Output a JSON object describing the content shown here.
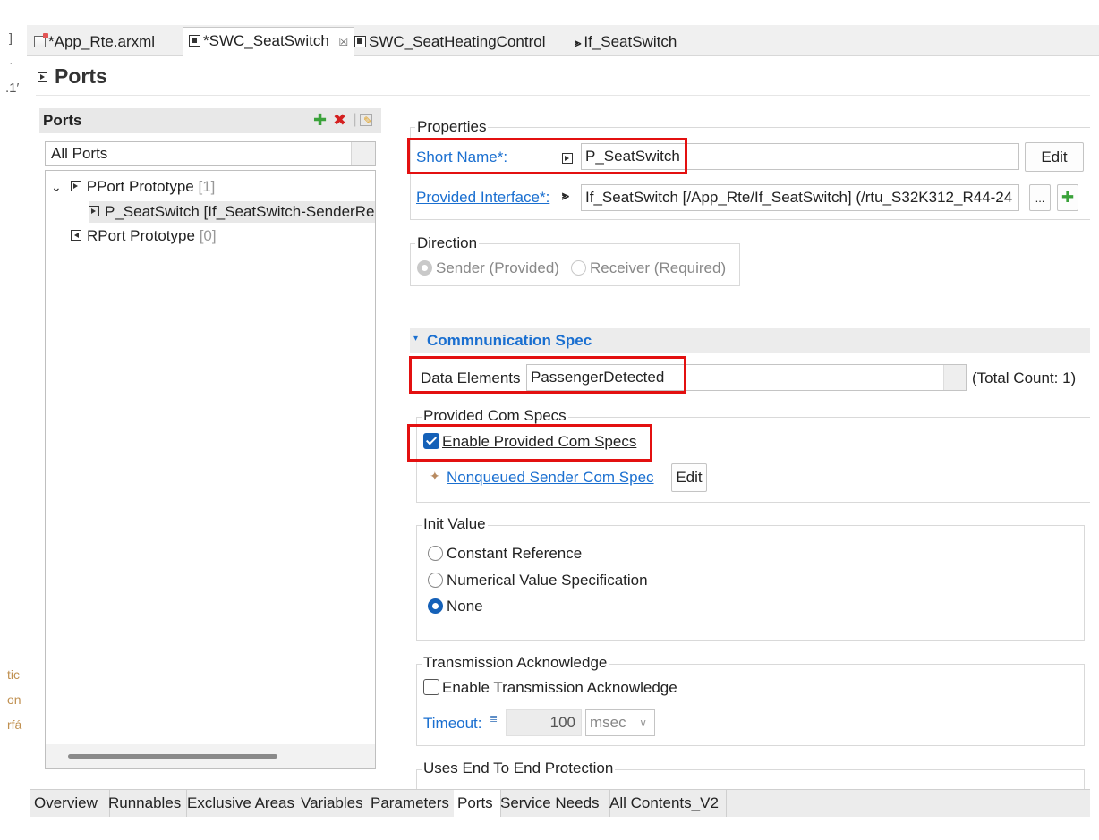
{
  "tabs": [
    {
      "label": "*App_Rte.arxml",
      "icon": "arxml-file-icon"
    },
    {
      "label": "*SWC_SeatSwitch",
      "icon": "swc-component-icon",
      "close": "☒"
    },
    {
      "label": "SWC_SeatHeatingControl",
      "icon": "swc-component-icon"
    },
    {
      "label": "If_SeatSwitch",
      "icon": "interface-arrow-icon"
    }
  ],
  "left_edge_fragments": [
    "]",
    "·",
    ".1′",
    "tic",
    "on",
    "rfá"
  ],
  "page_title": "Ports",
  "ports_panel": {
    "title": "Ports",
    "filter_value": "All Ports",
    "tree": [
      {
        "label": "PPort Prototype",
        "count": "[1]",
        "expander": "⌄"
      },
      {
        "label": "P_SeatSwitch [If_SeatSwitch-SenderRe"
      },
      {
        "label": "RPort Prototype",
        "count": "[0]"
      }
    ]
  },
  "properties": {
    "group_label": "Properties",
    "short_name_label": "Short Name*:",
    "short_name_value": "P_SeatSwitch",
    "edit_label": "Edit",
    "provided_interface_label": "Provided Interface*:",
    "provided_interface_value": "If_SeatSwitch [/App_Rte/If_SeatSwitch] (/rtu_S32K312_R44-24",
    "browse_label": "..."
  },
  "direction": {
    "group_label": "Direction",
    "sender": "Sender (Provided)",
    "receiver": "Receiver (Required)"
  },
  "comm_spec": {
    "title": "Commnunication Spec",
    "data_elements_label": "Data Elements",
    "data_elements_value": "PassengerDetected",
    "total_count": "(Total Count: 1)",
    "provided_group_label": "Provided Com Specs",
    "enable_provided": "Enable Provided Com Specs",
    "nonqueued_link": "Nonqueued Sender Com Spec",
    "edit_label": "Edit"
  },
  "init_value": {
    "group_label": "Init Value",
    "options": [
      "Constant Reference",
      "Numerical Value Specification",
      "None"
    ],
    "selected": "None"
  },
  "transmission": {
    "group_label": "Transmission Acknowledge",
    "enable": "Enable Transmission Acknowledge",
    "timeout_label": "Timeout:",
    "timeout_value": "100",
    "unit": "msec"
  },
  "e2e": {
    "group_label": "Uses End To End Protection"
  },
  "bottom_tabs": [
    "Overview",
    "Runnables",
    "Exclusive Areas",
    "Variables",
    "Parameters",
    "Ports",
    "Service Needs",
    "All Contents_V2"
  ],
  "active_bottom_tab": "Ports",
  "colors": {
    "accent": "#1561b8",
    "link": "#1a6fd0",
    "highlight": "#e31010"
  }
}
